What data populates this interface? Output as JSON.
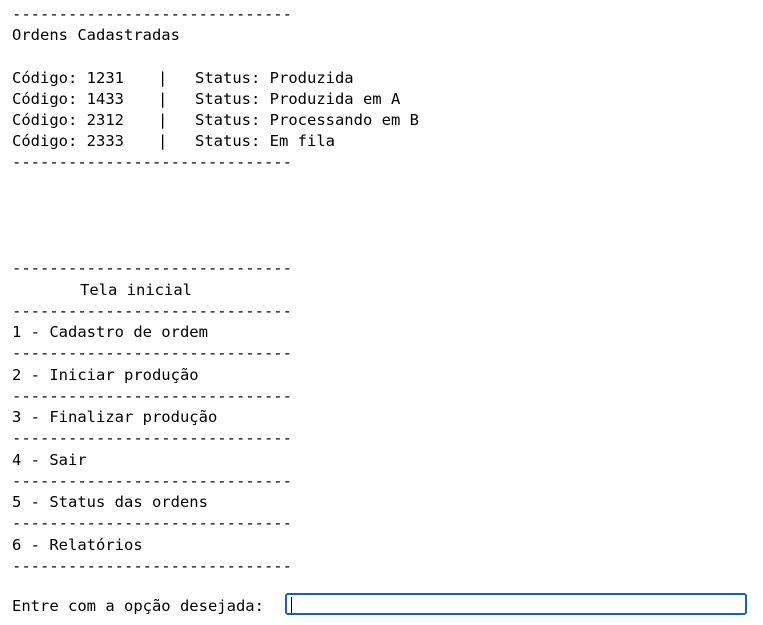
{
  "separator": "------------------------------",
  "orders": {
    "title": "Ordens Cadastradas",
    "rows": [
      {
        "code": "Código: 1231",
        "bar": "|",
        "status": "Status: Produzida"
      },
      {
        "code": "Código: 1433",
        "bar": "|",
        "status": "Status: Produzida em A"
      },
      {
        "code": "Código: 2312",
        "bar": "|",
        "status": "Status: Processando em B"
      },
      {
        "code": "Código: 2333",
        "bar": "|",
        "status": "Status: Em fila"
      }
    ]
  },
  "menu": {
    "title": "Tela inicial",
    "items": [
      "1 - Cadastro de ordem",
      "2 - Iniciar produção",
      "3 - Finalizar produção",
      "4 - Sair",
      "5 - Status das ordens",
      "6 - Relatórios"
    ]
  },
  "prompt": {
    "label": "Entre com a opção desejada:",
    "value": ""
  }
}
